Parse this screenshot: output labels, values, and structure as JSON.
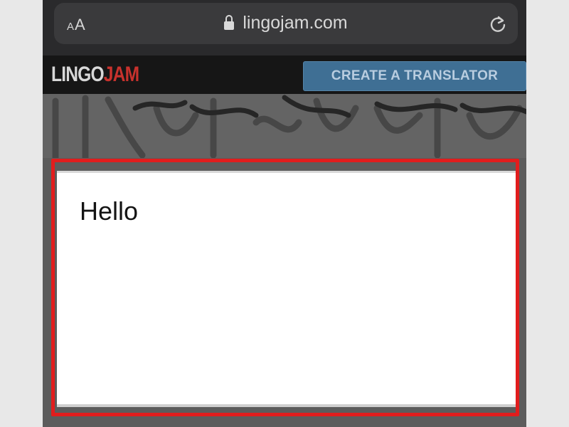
{
  "browser": {
    "text_size_label": "AA",
    "url": "lingojam.com"
  },
  "site": {
    "logo_part1": "LINGO",
    "logo_part2": "JAM",
    "create_button_label": "CREATE A TRANSLATOR"
  },
  "translator": {
    "input_value": "Hello"
  },
  "colors": {
    "highlight": "#e11d1d",
    "button": "#3f6f94",
    "logo_accent": "#c8322d"
  }
}
